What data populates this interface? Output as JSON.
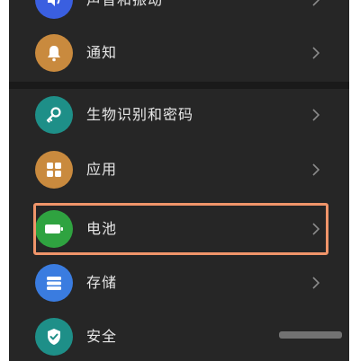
{
  "settings": {
    "items": [
      {
        "label": "声音和振动",
        "icon": "speaker-icon",
        "color": "#3a5fe0"
      },
      {
        "label": "通知",
        "icon": "bell-icon",
        "color": "#c98a3e"
      },
      {
        "label": "生物识别和密码",
        "icon": "key-icon",
        "color": "#1e8f88"
      },
      {
        "label": "应用",
        "icon": "apps-grid-icon",
        "color": "#c98a3e"
      },
      {
        "label": "电池",
        "icon": "battery-icon",
        "color": "#2fa340"
      },
      {
        "label": "存储",
        "icon": "storage-icon",
        "color": "#3a7ce0"
      },
      {
        "label": "安全",
        "icon": "shield-icon",
        "color": "#1e8f88"
      }
    ],
    "highlighted_item": "电池",
    "highlight_color": "#f0956a"
  }
}
